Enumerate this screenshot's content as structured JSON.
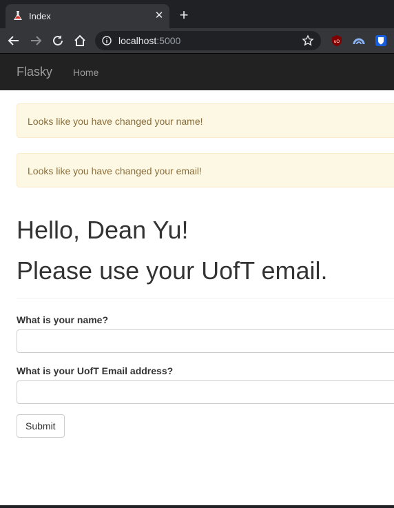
{
  "browser": {
    "tab_title": "Index",
    "url_host": "localhost",
    "url_port": ":5000",
    "icons": {
      "favicon": "flask-icon",
      "close": "close-icon",
      "new_tab": "plus-icon",
      "back": "arrow-left-icon",
      "forward": "arrow-right-icon",
      "reload": "reload-icon",
      "home": "home-icon",
      "info": "info-icon",
      "bookmark": "star-icon",
      "ext_ublock": "ublock-icon",
      "ext_arc": "arc-icon",
      "ext_bitwarden": "bitwarden-icon"
    }
  },
  "navbar": {
    "brand": "Flasky",
    "links": [
      {
        "label": "Home"
      }
    ]
  },
  "flashes": [
    "Looks like you have changed your name!",
    "Looks like you have changed your email!"
  ],
  "header": {
    "greeting": "Hello, Dean Yu!",
    "message": "Please use your UofT email."
  },
  "form": {
    "name_label": "What is your name?",
    "name_value": "",
    "email_label": "What is your UofT Email address?",
    "email_value": "",
    "submit_label": "Submit"
  },
  "colors": {
    "navbar_bg": "#222222",
    "alert_bg": "#fcf8e3",
    "alert_text": "#8a6d3b"
  }
}
